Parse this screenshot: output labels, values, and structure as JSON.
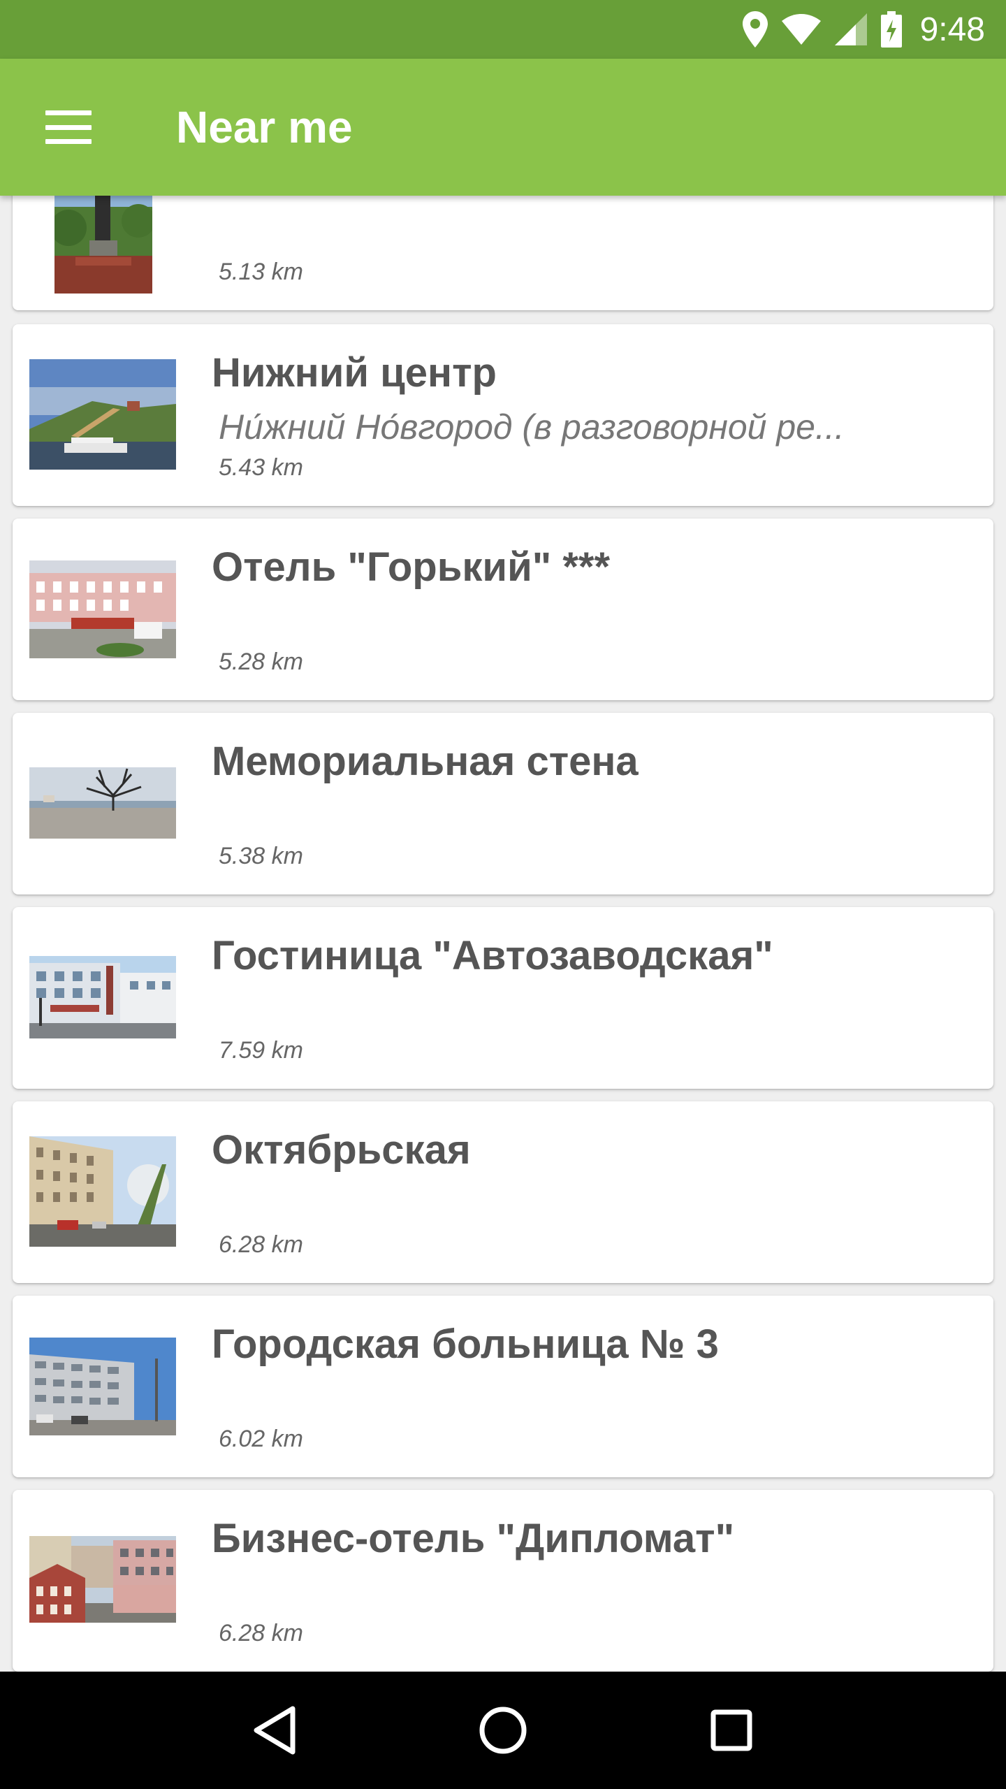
{
  "status_bar": {
    "time": "9:48",
    "icons": [
      "location-icon",
      "wifi-icon",
      "signal-icon",
      "battery-charging-icon"
    ]
  },
  "app_bar": {
    "menu_icon": "hamburger-menu-icon",
    "title": "Near me"
  },
  "places": [
    {
      "title": "",
      "description": "",
      "distance": "5.13 km",
      "thumb": "monument"
    },
    {
      "title": "Нижний центр",
      "description": "Ни́жний Но́вгород (в разговорной ре...",
      "distance": "5.43 km",
      "thumb": "riverside"
    },
    {
      "title": "Отель \"Горький\" ***",
      "description": "",
      "distance": "5.28 km",
      "thumb": "street-building"
    },
    {
      "title": "Мемориальная стена",
      "description": "",
      "distance": "5.38 km",
      "thumb": "tree-embankment"
    },
    {
      "title": "Гостиница \"Автозаводская\"",
      "description": "",
      "distance": "7.59 km",
      "thumb": "hotel-building"
    },
    {
      "title": "Октябрьская",
      "description": "",
      "distance": "6.28 km",
      "thumb": "apartment-street"
    },
    {
      "title": "Городская больница № 3",
      "description": "",
      "distance": "6.02 km",
      "thumb": "hospital"
    },
    {
      "title": "Бизнес-отель \"Дипломат\"",
      "description": "",
      "distance": "6.28 km",
      "thumb": "brick-buildings"
    }
  ],
  "nav_bar": {
    "back_icon": "back-triangle-icon",
    "home_icon": "home-circle-icon",
    "recents_icon": "recents-square-icon"
  },
  "colors": {
    "status_bar": "#689f38",
    "app_bar": "#8bc34a",
    "background": "#efefef"
  }
}
